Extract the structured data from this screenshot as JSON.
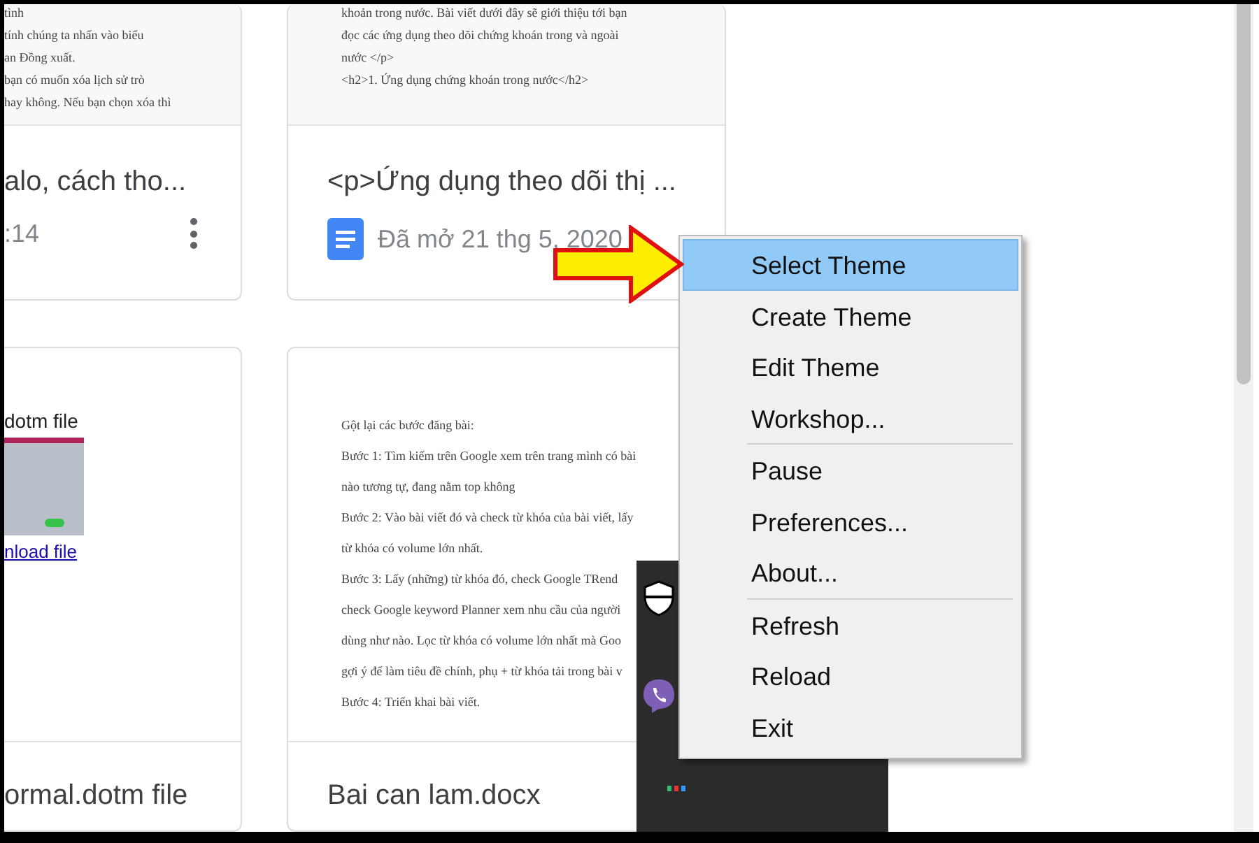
{
  "cards": [
    {
      "preview": [
        {
          "kind": "text",
          "text": "tình"
        },
        {
          "kind": "text",
          "text": "tính chúng ta nhấn vào biểu"
        },
        {
          "kind": "text",
          "text": "an Đồng xuất."
        },
        {
          "kind": "text",
          "text": "bạn có muốn xóa lịch sử trò"
        },
        {
          "kind": "text",
          "text": "hay không. Nếu bạn chọn xóa thì"
        }
      ],
      "title": "alo, cách tho...",
      "meta": ":14",
      "doc_icon": false,
      "more": true
    },
    {
      "preview": [
        {
          "kind": "text",
          "text": "khoản trong nước. Bài viết dưới đây sẽ giới thiệu tới bạn"
        },
        {
          "kind": "text",
          "text": "đọc các ứng dụng theo dõi chứng khoán trong và ngoài"
        },
        {
          "kind": "text",
          "text": "nước </p>"
        },
        {
          "kind": "text",
          "text": "<h2>1. Ứng dụng chứng khoán trong nước</h2>"
        }
      ],
      "title": "<p>Ứng dụng theo dõi thị ...",
      "meta": "Đã mở 21 thg 5, 2020",
      "doc_icon": true,
      "more": false
    },
    {
      "preview": [
        {
          "kind": "heading",
          "text": "dotm file"
        },
        {
          "kind": "image"
        },
        {
          "kind": "link",
          "text": "nload file"
        }
      ],
      "title": "ormal.dotm file",
      "doc_icon": false,
      "more": false
    },
    {
      "preview": [
        {
          "kind": "text",
          "text": "Gột lại các bước đăng bài:"
        },
        {
          "kind": "text",
          "text": "Bước 1: Tìm kiếm trên Google xem trên trang mình có bài"
        },
        {
          "kind": "text",
          "text": "nào tương tự, đang nằm top không"
        },
        {
          "kind": "text",
          "text": "Bước 2: Vào bài viết đó và check từ khóa của bài viết, lấy"
        },
        {
          "kind": "text",
          "text": "từ khóa có volume lớn nhất."
        },
        {
          "kind": "text",
          "text": "Bước 3: Lấy (những) từ khóa đó, check Google TRend"
        },
        {
          "kind": "text",
          "text": "check Google keyword Planner xem nhu cầu của người"
        },
        {
          "kind": "text",
          "text": "dùng như nào. Lọc từ khóa có volume lớn nhất mà Goo"
        },
        {
          "kind": "text",
          "text": "gợi ý để làm tiêu đề chính, phụ + từ khóa tải trong bài v"
        },
        {
          "kind": "text",
          "text": "Bước 4: Triển khai bài viết."
        }
      ],
      "title": "Bai can lam.docx",
      "doc_icon": false,
      "more": false
    }
  ],
  "menu": {
    "groups": [
      [
        {
          "label": "Select Theme",
          "selected": true
        },
        {
          "label": "Create Theme",
          "selected": false
        },
        {
          "label": "Edit Theme",
          "selected": false
        },
        {
          "label": "Workshop...",
          "selected": false
        }
      ],
      [
        {
          "label": "Pause",
          "selected": false
        },
        {
          "label": "Preferences...",
          "selected": false
        },
        {
          "label": "About...",
          "selected": false
        }
      ],
      [
        {
          "label": "Refresh",
          "selected": false
        },
        {
          "label": "Reload",
          "selected": false
        },
        {
          "label": "Exit",
          "selected": false
        }
      ]
    ]
  }
}
